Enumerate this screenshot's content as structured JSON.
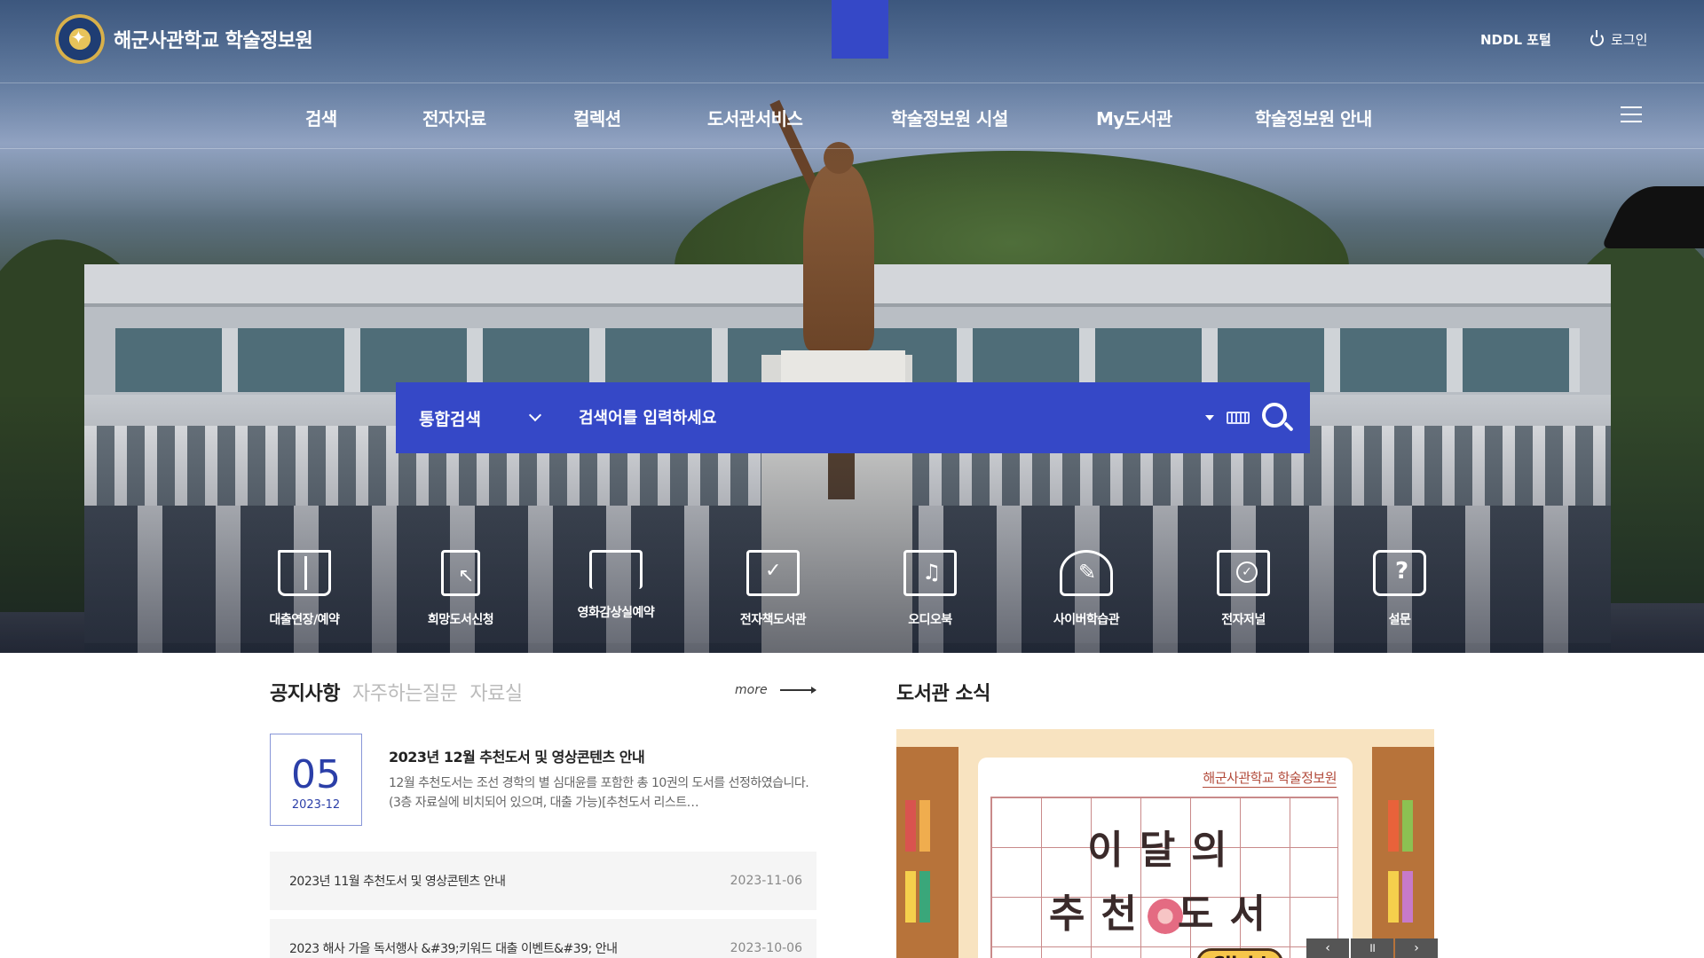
{
  "header": {
    "site_title": "해군사관학교 학술정보원",
    "nddl_label": "NDDL 포털",
    "login_label": "로그인"
  },
  "gnb": [
    {
      "label": "검색"
    },
    {
      "label": "전자자료"
    },
    {
      "label": "컬렉션"
    },
    {
      "label": "도서관서비스"
    },
    {
      "label": "학술정보원 시설"
    },
    {
      "label": "My도서관"
    },
    {
      "label": "학술정보원 안내"
    }
  ],
  "search": {
    "scope": "통합검색",
    "placeholder": "검색어를 입력하세요"
  },
  "quick_links": [
    {
      "label": "대출연장/예약",
      "icon": "book-icon"
    },
    {
      "label": "희망도서신청",
      "icon": "file-cursor-icon"
    },
    {
      "label": "영화감상실예약",
      "icon": "desk-icon"
    },
    {
      "label": "전자책도서관",
      "icon": "monitor-check-icon"
    },
    {
      "label": "오디오북",
      "icon": "audio-book-icon"
    },
    {
      "label": "사이버학습관",
      "icon": "person-study-icon"
    },
    {
      "label": "전자저널",
      "icon": "journal-check-icon"
    },
    {
      "label": "설문",
      "icon": "survey-bubble-icon"
    }
  ],
  "notice": {
    "tabs": [
      "공지사항",
      "자주하는질문",
      "자료실"
    ],
    "more_label": "more",
    "featured": {
      "day": "05",
      "year_month": "2023-12",
      "title": "2023년 12월 추천도서 및 영상콘텐츠 안내",
      "desc": "12월 추천도서는 조선 경학의 별 심대윤를 포함한 총 10권의 도서를 선정하였습니다.(3층 자료실에 비치되어 있으며, 대출 가능)[추천도서 리스트…"
    },
    "items": [
      {
        "title": "2023년 11월 추천도서 및 영상콘텐츠 안내",
        "date": "2023-11-06"
      },
      {
        "title": "2023 해사 가을 독서행사 &#39;키워드 대출 이벤트&#39; 안내",
        "date": "2023-10-06"
      }
    ]
  },
  "news": {
    "title": "도서관 소식",
    "card_org": "해군사관학교 학술정보원",
    "card_line1": "이달의",
    "card_line2_a": "추천",
    "card_line2_b": "도서",
    "card_button": "Click!"
  },
  "colors": {
    "primary": "#3548c7",
    "accent_text": "#2b3fa8"
  }
}
